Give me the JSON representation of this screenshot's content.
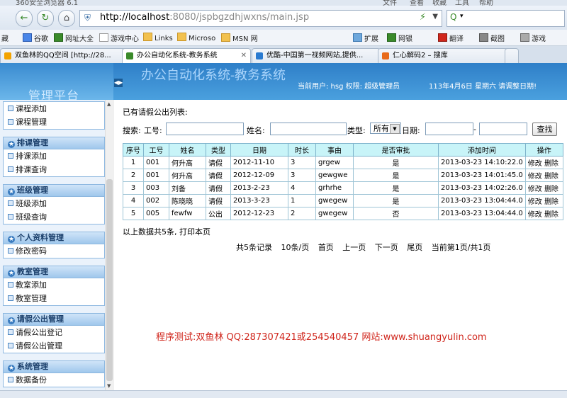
{
  "browser": {
    "title": "360安全浏览器 6.1",
    "menu": [
      "文件",
      "查看",
      "收藏",
      "工具",
      "帮助"
    ],
    "url_host": "http://localhost",
    "url_rest": ":8080/jspbgzdhjwxns/main.jsp",
    "bookmarks": [
      "藏",
      "谷歌",
      "网址大全",
      "游戏中心",
      "Links",
      "Microso",
      "MSN 网",
      "扩展",
      "网银",
      "翻译",
      "截图",
      "游戏"
    ],
    "tabs": [
      {
        "label": "双鱼林的QQ空间 [http://28...",
        "color": "#f3a300"
      },
      {
        "label": "办公自动化系统-教务系统",
        "color": "#3a8a2a"
      },
      {
        "label": "优酷-中国第一视频网站,提供...",
        "color": "#2a7ad0"
      },
      {
        "label": "仁心解码2 – 搜库",
        "color": "#e86a1a"
      }
    ]
  },
  "header": {
    "brand": "管理平台",
    "collapse_icon": "◀▶",
    "system_title": "办公自动化系统-教务系统",
    "user_info": "当前用户: hsg  权限: 超级管理员",
    "date_info": "113年4月6日  星期六   请调整日期!"
  },
  "sidebar": {
    "top_items": [
      "课程添加",
      "课程管理"
    ],
    "groups": [
      {
        "title": "排课管理",
        "items": [
          "排课添加",
          "排课查询"
        ]
      },
      {
        "title": "班级管理",
        "items": [
          "班级添加",
          "班级查询"
        ]
      },
      {
        "title": "个人资料管理",
        "items": [
          "修改密码"
        ]
      },
      {
        "title": "教室管理",
        "items": [
          "教室添加",
          "教室管理"
        ]
      },
      {
        "title": "请假公出管理",
        "items": [
          "请假公出登记",
          "请假公出管理"
        ]
      },
      {
        "title": "系统管理",
        "items": [
          "数据备份"
        ]
      }
    ]
  },
  "main": {
    "list_label": "已有请假公出列表:",
    "search": {
      "prefix": "搜索:",
      "job_no_label": "工号:",
      "name_label": "姓名:",
      "type_label": "类型:",
      "type_value": "所有",
      "date_label": "日期:",
      "date_sep": "-",
      "button": "查找"
    },
    "table": {
      "headers": [
        "序号",
        "工号",
        "姓名",
        "类型",
        "日期",
        "时长",
        "事由",
        "是否审批",
        "添加时间",
        "操作"
      ],
      "rows": [
        [
          "1",
          "001",
          "何升高",
          "请假",
          "2012-11-10",
          "3",
          "grgew",
          "是",
          "2013-03-23 14:10:22.0"
        ],
        [
          "2",
          "001",
          "何升高",
          "请假",
          "2012-12-09",
          "3",
          "gewgwe",
          "是",
          "2013-03-23 14:01:45.0"
        ],
        [
          "3",
          "003",
          "刘备",
          "请假",
          "2013-2-23",
          "4",
          "grhrhe",
          "是",
          "2013-03-23 14:02:26.0"
        ],
        [
          "4",
          "002",
          "陈晓晓",
          "请假",
          "2013-3-23",
          "1",
          "gwegew",
          "是",
          "2013-03-23 13:04:44.0"
        ],
        [
          "5",
          "005",
          "fewfw",
          "公出",
          "2012-12-23",
          "2",
          "gwegew",
          "否",
          "2013-03-23 13:04:44.0"
        ]
      ],
      "edit_label": "修改",
      "delete_label": "删除"
    },
    "summary": "以上数据共5条, 打印本页",
    "pager": [
      "共5条记录",
      "10条/页",
      "首页",
      "上一页",
      "下一页",
      "尾页",
      "当前第1页/共1页"
    ],
    "credit": "程序测试:双鱼林 QQ:287307421或254540457 网站:www.shuangyulin.com"
  }
}
